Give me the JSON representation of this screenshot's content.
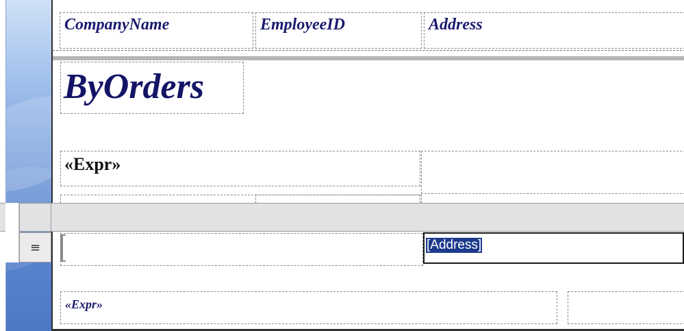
{
  "header": {
    "labels": [
      "CompanyName",
      "EmployeeID",
      "Address"
    ]
  },
  "report": {
    "title": "ByOrders",
    "group_expr": "«Expr»",
    "detail_field": "[Address]",
    "footer_expr": "«Expr»"
  },
  "row_selector": {
    "icon": "≡"
  },
  "colors": {
    "label_text": "#1a1a6e",
    "selection_bg": "#1c3a8c",
    "band_gray": "#e2e2e4",
    "side_blue": "#5c87cf"
  }
}
